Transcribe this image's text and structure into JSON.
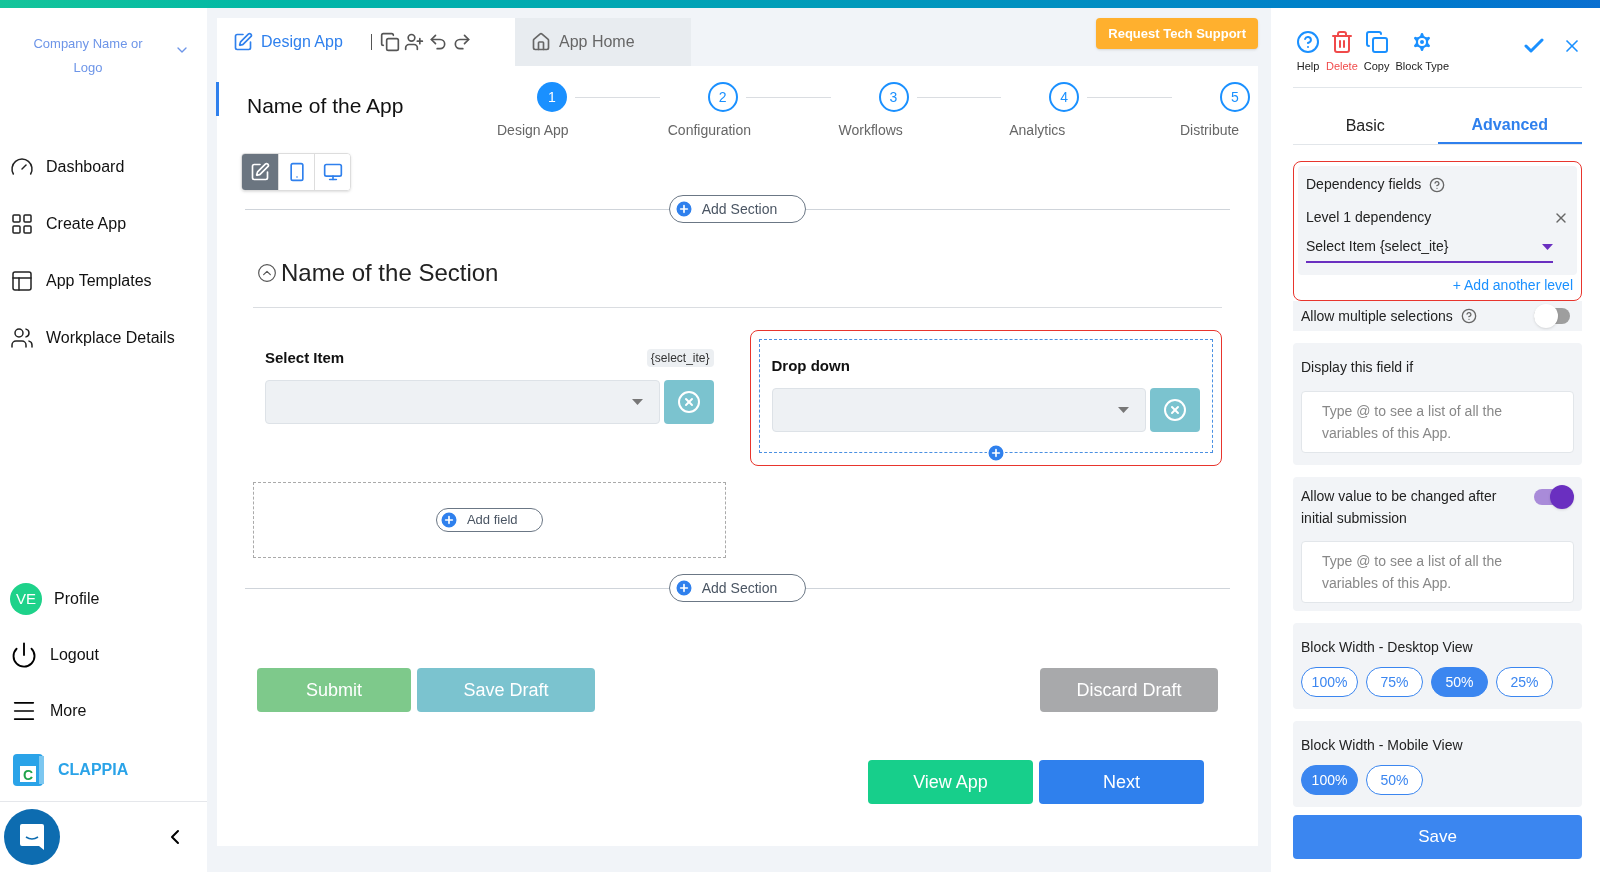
{
  "company": {
    "name": "Company Name or Logo"
  },
  "nav": [
    {
      "label": "Dashboard",
      "kind": "dashboard"
    },
    {
      "label": "Create App",
      "kind": "create"
    },
    {
      "label": "App Templates",
      "kind": "templates"
    },
    {
      "label": "Workplace Details",
      "kind": "workplace"
    }
  ],
  "bottom_nav": [
    {
      "label": "Profile",
      "kind": "avatar",
      "initials": "VE"
    },
    {
      "label": "Logout",
      "kind": "logout"
    },
    {
      "label": "More",
      "kind": "more"
    }
  ],
  "brand": {
    "name": "CLAPPIA",
    "logo_letter": "C"
  },
  "tabs": [
    {
      "label": "Design App",
      "selected": true
    },
    {
      "label": "App Home",
      "selected": false
    }
  ],
  "support_button": "Request Tech Support",
  "app_name": "Name of the App",
  "steps": [
    {
      "number": "1",
      "label": "Design App",
      "selected": true
    },
    {
      "number": "2",
      "label": "Configuration",
      "selected": false
    },
    {
      "number": "3",
      "label": "Workflows",
      "selected": false
    },
    {
      "number": "4",
      "label": "Analytics",
      "selected": false
    },
    {
      "number": "5",
      "label": "Distribute",
      "selected": false
    }
  ],
  "view_modes": [
    {
      "kind": "edit",
      "selected": true
    },
    {
      "kind": "mobile",
      "selected": false
    },
    {
      "kind": "desktop",
      "selected": false
    }
  ],
  "add_section_buttons": [
    "Add Section",
    "Add Section"
  ],
  "section": {
    "title": "Name of the Section"
  },
  "fields": [
    {
      "label": "Select Item",
      "variable": "{select_ite}",
      "highlighted": false
    },
    {
      "label": "Drop down",
      "highlighted": true
    }
  ],
  "add_field": "Add field",
  "form_buttons": [
    {
      "label": "Submit",
      "kind": "submit"
    },
    {
      "label": "Save Draft",
      "kind": "draft"
    },
    {
      "label": "Discard Draft",
      "kind": "discard"
    }
  ],
  "footer_buttons": [
    {
      "label": "View App",
      "kind": "view"
    },
    {
      "label": "Next",
      "kind": "next"
    }
  ],
  "panel": {
    "actions": [
      {
        "label": "Help",
        "kind": "help"
      },
      {
        "label": "Delete",
        "kind": "delete"
      },
      {
        "label": "Copy",
        "kind": "copy"
      },
      {
        "label": "Block Type",
        "kind": "type"
      }
    ],
    "tabs": [
      {
        "label": "Basic",
        "selected": false
      },
      {
        "label": "Advanced",
        "selected": true
      }
    ],
    "dependency": {
      "title": "Dependency fields",
      "level_label": "Level 1 dependency",
      "value": "Select Item {select_ite}",
      "add_level": "+ Add another level"
    },
    "multiple": {
      "label": "Allow multiple selections",
      "on": false
    },
    "display_if": {
      "label": "Display this field if",
      "placeholder": "Type @ to see a list of all the variables of this App."
    },
    "change_after": {
      "label": "Allow value to be changed after initial submission",
      "on": true,
      "placeholder": "Type @ to see a list of all the variables of this App."
    },
    "widths": [
      {
        "title": "Block Width - Desktop View",
        "options": [
          {
            "label": "100%",
            "selected": false
          },
          {
            "label": "75%",
            "selected": false
          },
          {
            "label": "50%",
            "selected": true
          },
          {
            "label": "25%",
            "selected": false
          }
        ]
      },
      {
        "title": "Block Width - Mobile View",
        "options": [
          {
            "label": "100%",
            "selected": true
          },
          {
            "label": "50%",
            "selected": false
          }
        ]
      }
    ],
    "save": "Save"
  }
}
